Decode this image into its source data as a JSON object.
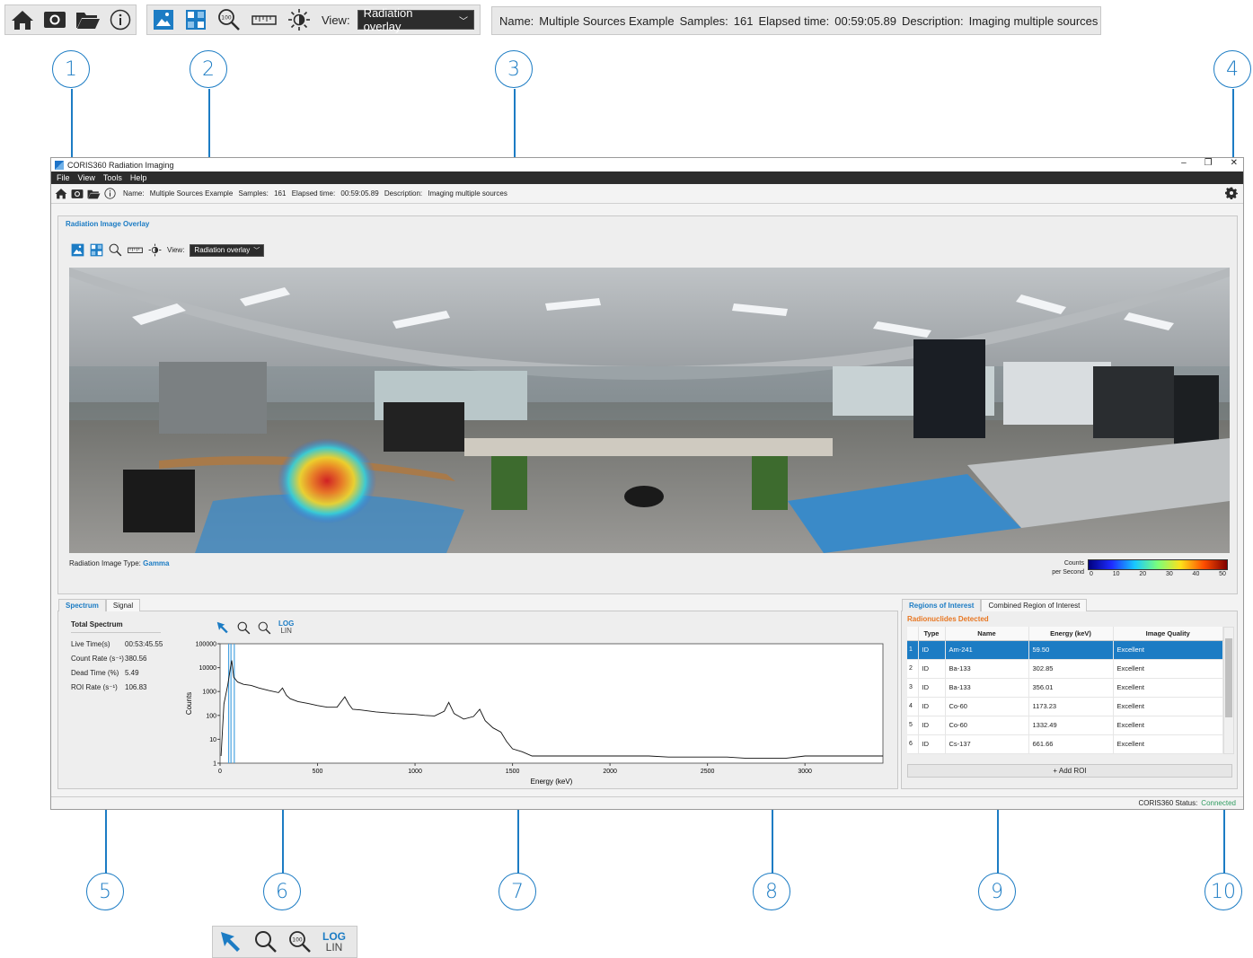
{
  "info": {
    "name_label": "Name:",
    "name_value": "Multiple Sources Example",
    "samples_label": "Samples:",
    "samples_value": "161",
    "elapsed_label": "Elapsed time:",
    "elapsed_value": "00:59:05.89",
    "desc_label": "Description:",
    "desc_value": "Imaging multiple sources"
  },
  "view": {
    "label": "View:",
    "selected": "Radiation overlay"
  },
  "callouts": [
    "1",
    "2",
    "3",
    "4",
    "5",
    "6",
    "7",
    "8",
    "9",
    "10"
  ],
  "window": {
    "title": "CORIS360 Radiation Imaging",
    "controls": [
      "–",
      "❐",
      "✕"
    ],
    "menu": [
      "File",
      "View",
      "Tools",
      "Help"
    ]
  },
  "overlay": {
    "title": "Radiation Image Overlay",
    "image_type_label": "Radiation Image Type:",
    "image_type_value": "Gamma",
    "colorbar_label_1": "Counts",
    "colorbar_label_2": "per Second",
    "colorbar_ticks": [
      "0",
      "10",
      "20",
      "30",
      "40",
      "50"
    ]
  },
  "spectrum": {
    "tabs": [
      "Spectrum",
      "Signal"
    ],
    "header": "Total Spectrum",
    "stats": [
      {
        "k": "Live Time(s)",
        "v": "00:53:45.55"
      },
      {
        "k": "Count Rate (s⁻¹)",
        "v": "380.56"
      },
      {
        "k": "Dead Time (%)",
        "v": "5.49"
      },
      {
        "k": "ROI Rate (s⁻¹)",
        "v": "106.83"
      }
    ],
    "log_label": "LOG",
    "lin_label": "LIN"
  },
  "chart_data": {
    "type": "line",
    "title": "",
    "xlabel": "Energy (keV)",
    "ylabel": "Counts",
    "yscale": "log",
    "xlim": [
      0,
      3400
    ],
    "ylim": [
      1,
      100000
    ],
    "x_ticks": [
      "0",
      "500",
      "1000",
      "1500",
      "2000",
      "2500",
      "3000"
    ],
    "y_ticks": [
      "1",
      "10",
      "100",
      "1000",
      "10000",
      "100000"
    ],
    "series": [
      {
        "x": [
          5,
          20,
          40,
          55,
          60,
          70,
          90,
          120,
          160,
          200,
          250,
          300,
          320,
          340,
          360,
          400,
          450,
          500,
          550,
          600,
          640,
          660,
          680,
          720,
          800,
          900,
          1000,
          1050,
          1100,
          1150,
          1173,
          1200,
          1250,
          1300,
          1332,
          1360,
          1400,
          1440,
          1470,
          1500,
          1550,
          1600,
          1700,
          1800,
          1900,
          2000,
          2100,
          2200,
          2300,
          2400,
          2500,
          2600,
          2700,
          2800,
          2900,
          3000,
          3100,
          3200,
          3300,
          3400
        ],
        "y": [
          2,
          300,
          2000,
          12000,
          20000,
          4000,
          2500,
          2000,
          1800,
          1400,
          1100,
          900,
          1400,
          700,
          500,
          380,
          320,
          260,
          220,
          220,
          600,
          300,
          180,
          170,
          140,
          120,
          110,
          100,
          95,
          150,
          350,
          120,
          70,
          90,
          180,
          60,
          30,
          20,
          8,
          4,
          3,
          2,
          2,
          2,
          2,
          2,
          2,
          2,
          1.8,
          1.8,
          1.8,
          1.8,
          1.6,
          1.6,
          1.6,
          2,
          2,
          2,
          2,
          2
        ]
      }
    ],
    "roi_markers_keV": [
      44,
      56,
      73
    ]
  },
  "roi": {
    "tabs": [
      "Regions of Interest",
      "Combined Region of Interest"
    ],
    "subtitle": "Radionuclides Detected",
    "columns": [
      "",
      "Type",
      "Name",
      "Energy (keV)",
      "Image Quality"
    ],
    "rows": [
      {
        "n": "1",
        "type": "ID",
        "name": "Am-241",
        "energy": "59.50",
        "quality": "Excellent"
      },
      {
        "n": "2",
        "type": "ID",
        "name": "Ba-133",
        "energy": "302.85",
        "quality": "Excellent"
      },
      {
        "n": "3",
        "type": "ID",
        "name": "Ba-133",
        "energy": "356.01",
        "quality": "Excellent"
      },
      {
        "n": "4",
        "type": "ID",
        "name": "Co-60",
        "energy": "1173.23",
        "quality": "Excellent"
      },
      {
        "n": "5",
        "type": "ID",
        "name": "Co-60",
        "energy": "1332.49",
        "quality": "Excellent"
      },
      {
        "n": "6",
        "type": "ID",
        "name": "Cs-137",
        "energy": "661.66",
        "quality": "Excellent"
      }
    ],
    "add_label": "+ Add ROI"
  },
  "status": {
    "label": "CORIS360 Status:",
    "value": "Connected"
  },
  "colors": {
    "accent": "#1c7cc4",
    "orange": "#e87722",
    "connected": "#2e9b5f",
    "menubar": "#2c2c2c"
  }
}
